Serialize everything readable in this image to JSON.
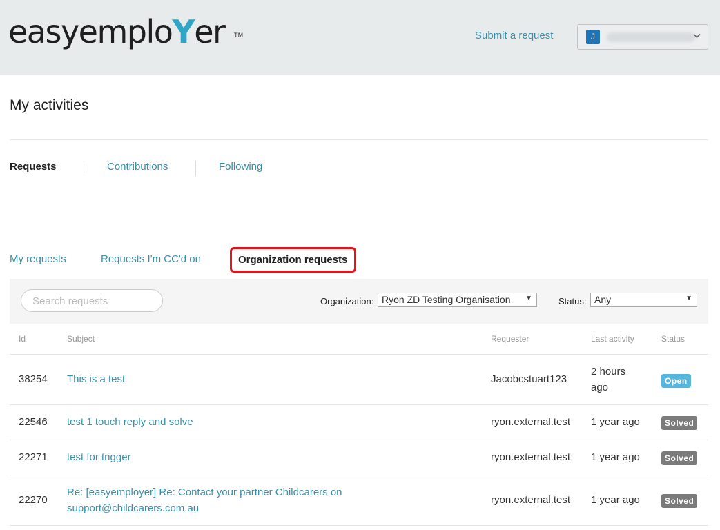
{
  "brand": {
    "logo_text_pre": "easyemplo",
    "logo_mark": "Y",
    "logo_text_post": "er",
    "trademark": "TM"
  },
  "header": {
    "submit_link": "Submit a request",
    "user_initial": "J"
  },
  "page": {
    "title": "My activities"
  },
  "main_tabs": [
    "Requests",
    "Contributions",
    "Following"
  ],
  "sub_tabs": [
    "My requests",
    "Requests I'm CC'd on",
    "Organization requests"
  ],
  "filters": {
    "search_placeholder": "Search requests",
    "organization_label": "Organization:",
    "organization_value": "Ryon ZD Testing Organisation",
    "status_label": "Status:",
    "status_value": "Any"
  },
  "table": {
    "headers": [
      "Id",
      "Subject",
      "Requester",
      "Last activity",
      "Status"
    ],
    "rows": [
      {
        "id": "38254",
        "subject": "This is a test",
        "requester": "Jacobcstuart123",
        "last_activity": "2 hours ago",
        "status": "Open"
      },
      {
        "id": "22546",
        "subject": "test 1 touch reply and solve",
        "requester": "ryon.external.test",
        "last_activity": "1 year ago",
        "status": "Solved"
      },
      {
        "id": "22271",
        "subject": "test for trigger",
        "requester": "ryon.external.test",
        "last_activity": "1 year ago",
        "status": "Solved"
      },
      {
        "id": "22270",
        "subject": "Re: [easyemployer] Re: Contact your partner Childcarers on support@childcarers.com.au",
        "requester": "ryon.external.test",
        "last_activity": "1 year ago",
        "status": "Solved"
      }
    ]
  },
  "colors": {
    "link": "#3a8fa9",
    "open_badge": "#56b6dc",
    "solved_badge": "#7b7b7b",
    "highlight_border": "#e0151d"
  }
}
